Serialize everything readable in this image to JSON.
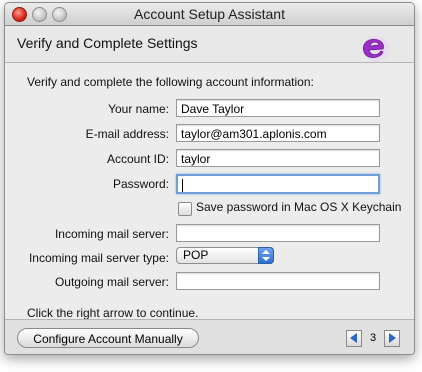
{
  "window": {
    "title": "Account Setup Assistant"
  },
  "header": {
    "title": "Verify and Complete Settings"
  },
  "form": {
    "intro": "Verify and complete the following account information:",
    "name_label": "Your name:",
    "name_value": "Dave Taylor",
    "email_label": "E-mail address:",
    "email_value": "taylor@am301.aplonis.com",
    "account_id_label": "Account ID:",
    "account_id_value": "taylor",
    "password_label": "Password:",
    "password_value": "",
    "keychain_label": "Save password in Mac OS X Keychain",
    "keychain_checked": false,
    "incoming_server_label": "Incoming mail server:",
    "incoming_server_value": "",
    "incoming_type_label": "Incoming mail server type:",
    "incoming_type_value": "POP",
    "outgoing_server_label": "Outgoing mail server:",
    "outgoing_server_value": "",
    "continue_text": "Click the right arrow to continue."
  },
  "footer": {
    "configure_manually_label": "Configure Account Manually",
    "page_number": "3"
  },
  "colors": {
    "accent": "#2a66c8",
    "logo": "#9b2fc9",
    "focus_ring": "#6e9fd6"
  }
}
